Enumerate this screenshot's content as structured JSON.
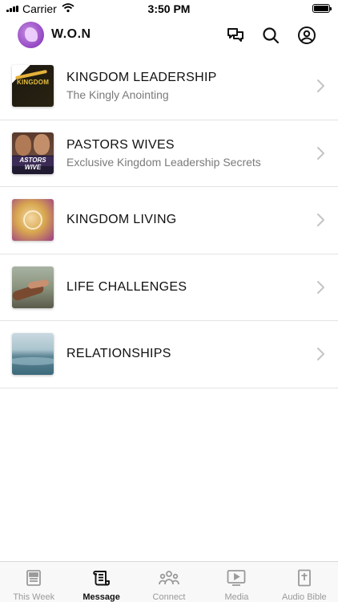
{
  "status_bar": {
    "carrier": "Carrier",
    "time": "3:50 PM"
  },
  "header": {
    "title": "W.O.N",
    "icons": [
      "chat-icon",
      "search-icon",
      "account-icon"
    ]
  },
  "items": [
    {
      "title": "KINGDOM LEADERSHIP",
      "subtitle": "The Kingly Anointing",
      "thumb_text": "KINGDOM"
    },
    {
      "title": "PASTORS WIVES",
      "subtitle": "Exclusive Kingdom Leadership Secrets",
      "thumb_text": "ASTORS WIVE"
    },
    {
      "title": "KINGDOM LIVING",
      "subtitle": ""
    },
    {
      "title": "LIFE CHALLENGES",
      "subtitle": ""
    },
    {
      "title": "RELATIONSHIPS",
      "subtitle": ""
    }
  ],
  "tabs": [
    {
      "label": "This Week",
      "icon": "newspaper-icon",
      "active": false
    },
    {
      "label": "Message",
      "icon": "scroll-icon",
      "active": true
    },
    {
      "label": "Connect",
      "icon": "people-icon",
      "active": false
    },
    {
      "label": "Media",
      "icon": "video-icon",
      "active": false
    },
    {
      "label": "Audio Bible",
      "icon": "bible-icon",
      "active": false
    }
  ],
  "colors": {
    "active_tab": "#111111",
    "inactive_tab": "#9a9a9a",
    "divider": "#e3e3e3",
    "subtitle": "#7a7a7a"
  }
}
